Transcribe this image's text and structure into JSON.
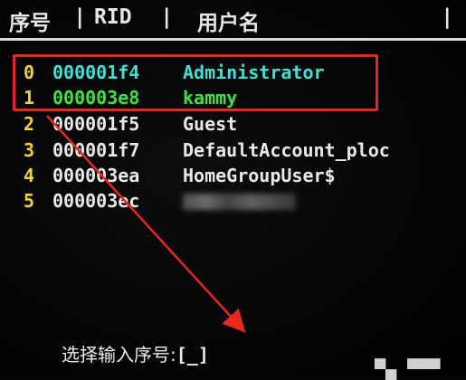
{
  "header": {
    "col_index": "序号",
    "sep1": "|",
    "col_rid": "RID",
    "sep2": "|",
    "col_username": "用户名",
    "sep3": "|"
  },
  "users": [
    {
      "index": "0",
      "rid": "000001f4",
      "name": "Administrator",
      "color": "#3ee0d8"
    },
    {
      "index": "1",
      "rid": "000003e8",
      "name": "kammy",
      "color": "#43e043"
    },
    {
      "index": "2",
      "rid": "000001f5",
      "name": "Guest",
      "color": "#e8e8e8"
    },
    {
      "index": "3",
      "rid": "000001f7",
      "name": "DefaultAccount_ploc",
      "color": "#e8e8e8"
    },
    {
      "index": "4",
      "rid": "000003ea",
      "name": "HomeGroupUser$",
      "color": "#e8e8e8"
    },
    {
      "index": "5",
      "rid": "000003ec",
      "name": "",
      "color": "#e8e8e8",
      "redacted": true
    }
  ],
  "prompt": {
    "label": "选择输入序号:",
    "input_value": "[_]"
  },
  "highlight_color": "#e8271f",
  "arrow_color": "#e8271f"
}
